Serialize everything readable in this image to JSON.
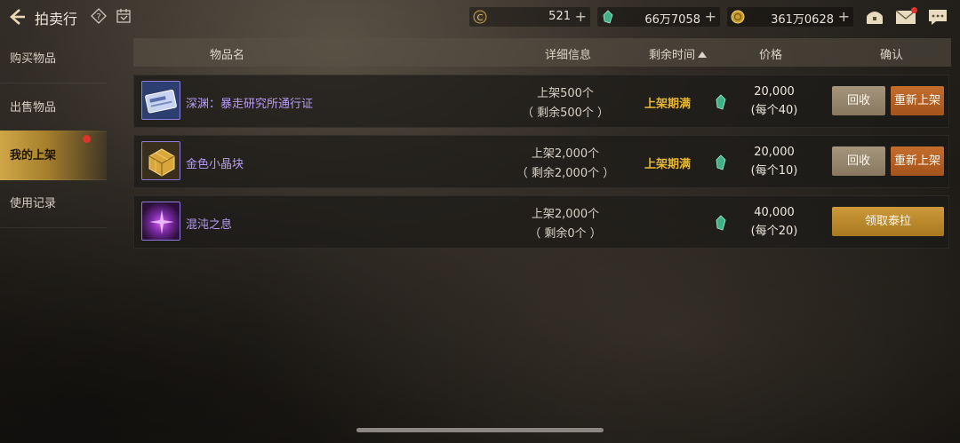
{
  "header": {
    "title": "拍卖行",
    "icons": {
      "back": "back-arrow-icon",
      "help": "help-diamond-icon",
      "calendar": "calendar-icon"
    }
  },
  "currencies": [
    {
      "icon": "c-coin-icon",
      "value": "521",
      "plus": "+"
    },
    {
      "icon": "green-gem-icon",
      "value": "66万7058",
      "plus": "+"
    },
    {
      "icon": "gold-coin-icon",
      "value": "361万0628",
      "plus": "+"
    }
  ],
  "top_icons": [
    "treasure-icon",
    "mail-icon",
    "chat-icon"
  ],
  "sidebar": {
    "items": [
      {
        "label": "购买物品"
      },
      {
        "label": "出售物品"
      },
      {
        "label": "我的上架"
      },
      {
        "label": "使用记录"
      }
    ],
    "active_index": 2
  },
  "table": {
    "columns": {
      "name": "物品名",
      "detail": "详细信息",
      "time": "剩余时间",
      "price": "价格",
      "confirm": "确认"
    },
    "rows": [
      {
        "name": "深渊：暴走研究所通行证",
        "detail_line1": "上架500个",
        "detail_line2": "（ 剩余500个 ）",
        "status": "上架期满",
        "price_total": "20,000",
        "price_each": "(每个40)",
        "btn1": "回收",
        "btn2": "重新上架"
      },
      {
        "name": "金色小晶块",
        "detail_line1": "上架2,000个",
        "detail_line2": "（ 剩余2,000个 ）",
        "status": "上架期满",
        "price_total": "20,000",
        "price_each": "(每个10)",
        "btn1": "回收",
        "btn2": "重新上架"
      },
      {
        "name": "混沌之息",
        "detail_line1": "上架2,000个",
        "detail_line2": "（ 剩余0个 ）",
        "status": "",
        "price_total": "40,000",
        "price_each": "(每个20)",
        "btn_claim": "领取泰拉"
      }
    ]
  },
  "colors": {
    "accent_gold": "#e8b833",
    "item_name": "#b79cf5",
    "recall_button": "#9a8b70",
    "relist_button": "#b8612a",
    "claim_button": "#bb8a2c"
  }
}
